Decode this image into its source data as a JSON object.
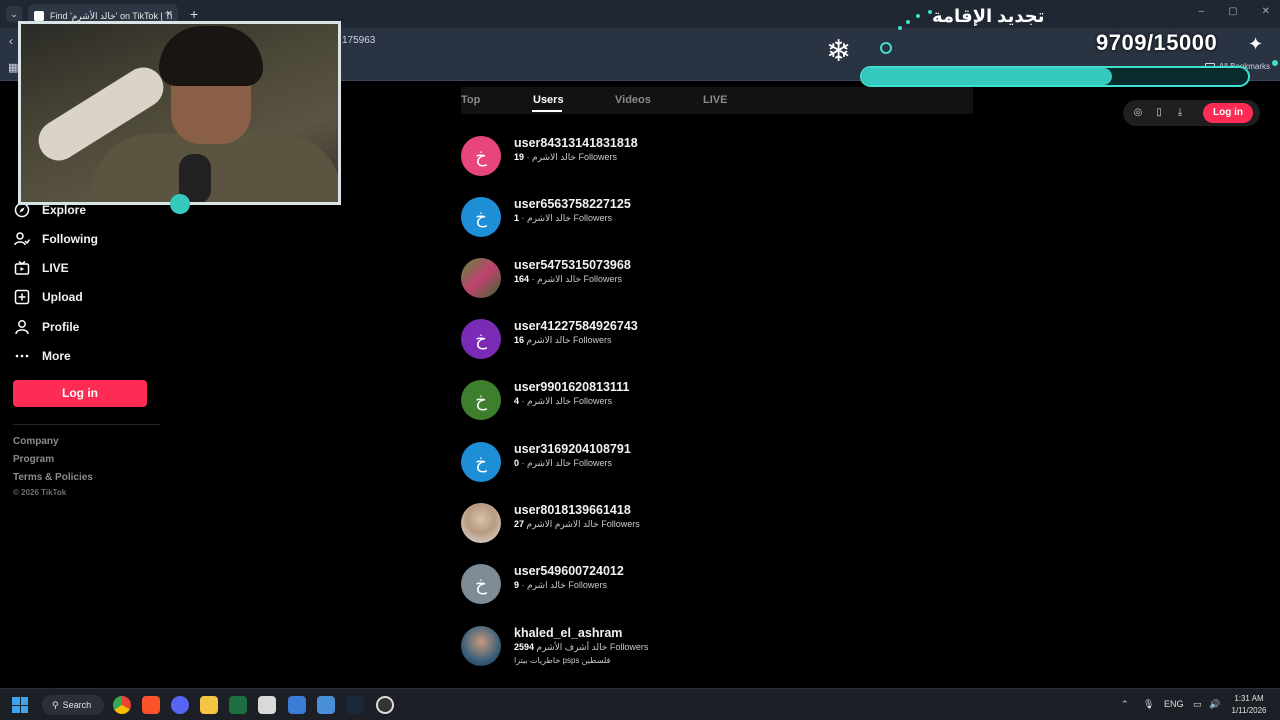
{
  "browser": {
    "tab_title": "Find 'خالد الأشرم' on TikTok | Ti",
    "tab_close": "×",
    "tab_new": "+",
    "tabs_menu": "⌄",
    "address_fragment": "175963",
    "all_bookmarks": "All Bookmarks",
    "window_controls": [
      "–",
      "▢",
      "✕"
    ]
  },
  "overlay": {
    "title": "تجديد الإقامة",
    "counter": "9709/15000",
    "progress_fraction": 0.647,
    "accent_color": "#3fe0d0",
    "snowflake": "❄",
    "sparkle": "✦"
  },
  "sidebar": {
    "items": [
      {
        "label": "Explore",
        "icon": "compass-icon"
      },
      {
        "label": "Following",
        "icon": "user-follow-icon"
      },
      {
        "label": "LIVE",
        "icon": "live-tv-icon"
      },
      {
        "label": "Upload",
        "icon": "upload-plus-icon"
      },
      {
        "label": "Profile",
        "icon": "profile-icon"
      },
      {
        "label": "More",
        "icon": "more-dots-icon"
      }
    ],
    "login_label": "Log in",
    "footer": [
      "Company",
      "Program",
      "Terms & Policies"
    ],
    "copyright": "© 2026 TikTok"
  },
  "search_tabs": [
    {
      "label": "Top",
      "active": false
    },
    {
      "label": "Users",
      "active": true
    },
    {
      "label": "Videos",
      "active": false
    },
    {
      "label": "LIVE",
      "active": false
    }
  ],
  "header": {
    "login_label": "Log in"
  },
  "users": [
    {
      "username": "user84313141831818",
      "nickname": "خالد الاشرم",
      "followers": "19",
      "followers_label": "Followers",
      "avatar_color": "#e8457a",
      "avatar_glyph": "خ"
    },
    {
      "username": "user6563758227125",
      "nickname": "خالد الاشرم",
      "followers": "1",
      "followers_label": "Followers",
      "avatar_color": "#1e8fd6",
      "avatar_glyph": "خ"
    },
    {
      "username": "user5475315073968",
      "nickname": "خالد الاشرم",
      "followers": "164",
      "followers_label": "Followers",
      "avatar_color": "#4a7a3c",
      "avatar_glyph": ""
    },
    {
      "username": "user41227584926743",
      "nickname": "خالد الاشرم",
      "followers": "16",
      "followers_label": "Followers",
      "avatar_color": "#7a2bb5",
      "avatar_glyph": "خ"
    },
    {
      "username": "user9901620813111",
      "nickname": "خالد الاشرم",
      "followers": "4",
      "followers_label": "Followers",
      "avatar_color": "#3e7f2e",
      "avatar_glyph": "خ"
    },
    {
      "username": "user3169204108791",
      "nickname": "خالد الاشرم",
      "followers": "0",
      "followers_label": "Followers",
      "avatar_color": "#1e8fd6",
      "avatar_glyph": "خ"
    },
    {
      "username": "user8018139661418",
      "nickname": "خالد الاشرم الاشرم",
      "followers": "27",
      "followers_label": "Followers",
      "avatar_color": "#c9b8a6",
      "avatar_glyph": ""
    },
    {
      "username": "user549600724012",
      "nickname": "خالد اشرم",
      "followers": "9",
      "followers_label": "Followers",
      "avatar_color": "#7f8c96",
      "avatar_glyph": "خ"
    },
    {
      "username": "khaled_el_ashram",
      "nickname": "خالد أشرف الأشرم",
      "followers": "2594",
      "followers_label": "Followers",
      "avatar_color": "#3a5f7a",
      "avatar_glyph": "",
      "bio": "خاطريات بيتزا psps فلسطين"
    }
  ],
  "taskbar": {
    "search_label": "Search",
    "language": "ENG",
    "time": "1:31 AM",
    "date": "1/11/2026"
  }
}
